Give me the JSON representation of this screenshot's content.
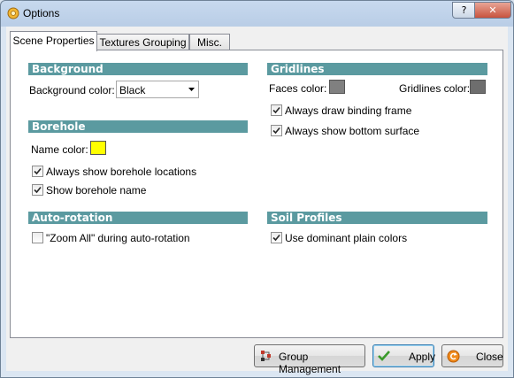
{
  "window": {
    "title": "Options",
    "help_label": "?",
    "close_label": "✕"
  },
  "tabs": [
    {
      "label": "Scene Properties",
      "active": true
    },
    {
      "label": "Textures  Grouping",
      "active": false
    },
    {
      "label": "Misc.",
      "active": false
    }
  ],
  "background": {
    "header": "Background",
    "color_label": "Background color:",
    "color_value": "Black"
  },
  "borehole": {
    "header": "Borehole",
    "name_color_label": "Name color:",
    "name_color": "#ffff00",
    "show_locations_label": "Always show borehole locations",
    "show_locations": true,
    "show_name_label": "Show borehole name",
    "show_name": true
  },
  "autorotation": {
    "header": "Auto-rotation",
    "zoom_all_label": "\"Zoom All\" during auto-rotation",
    "zoom_all": false
  },
  "gridlines": {
    "header": "Gridlines",
    "faces_color_label": "Faces color:",
    "faces_color": "#808080",
    "gridlines_color_label": "Gridlines color:",
    "gridlines_color": "#6e6e6e",
    "binding_frame_label": "Always draw binding frame",
    "binding_frame": true,
    "bottom_surface_label": "Always show bottom surface",
    "bottom_surface": true
  },
  "soil_profiles": {
    "header": "Soil Profiles",
    "dominant_colors_label": "Use dominant plain colors",
    "dominant_colors": true
  },
  "buttons": {
    "group_management": "Group Management",
    "apply": "Apply",
    "close": "Close"
  },
  "colors": {
    "header_bg": "#5b9aa0",
    "accent_focus": "#3c7fb1"
  }
}
